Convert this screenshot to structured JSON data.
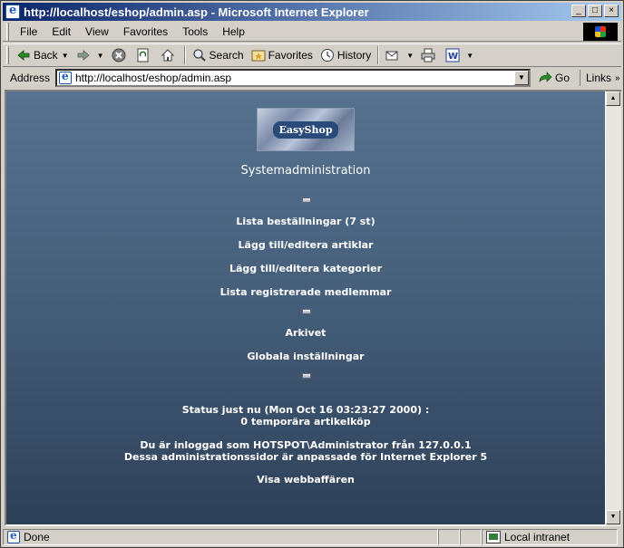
{
  "window": {
    "title": "http://localhost/eshop/admin.asp - Microsoft Internet Explorer",
    "controls": {
      "minimize": "_",
      "maximize": "□",
      "close": "×"
    }
  },
  "menubar": {
    "items": [
      "File",
      "Edit",
      "View",
      "Favorites",
      "Tools",
      "Help"
    ]
  },
  "toolbar": {
    "back": "Back",
    "search": "Search",
    "favorites": "Favorites",
    "history": "History"
  },
  "addressbar": {
    "label": "Address",
    "url": "http://localhost/eshop/admin.asp",
    "go": "Go",
    "links": "Links"
  },
  "page": {
    "logo_text": "EasyShop",
    "heading": "Systemadministration",
    "links": {
      "orders": "Lista beställningar (7 st)",
      "articles": "Lägg till/editera artiklar",
      "categories": "Lägg till/editera kategorier",
      "members": "Lista registrerade medlemmar",
      "archive": "Arkivet",
      "settings": "Globala inställningar",
      "shop": "Visa webbaffären"
    },
    "status_line1": "Status just nu (Mon Oct 16 03:23:27 2000) :",
    "status_line2": "0 temporära artikelköp",
    "login_line1": "Du är inloggad som HOTSPOT\\Administrator från 127.0.0.1",
    "login_line2": "Dessa administrationssidor är anpassade för Internet Explorer 5"
  },
  "statusbar": {
    "text": "Done",
    "zone": "Local intranet"
  },
  "colors": {
    "titlebar_start": "#0a246a",
    "content_top": "#56728e",
    "content_bottom": "#2e4058"
  }
}
